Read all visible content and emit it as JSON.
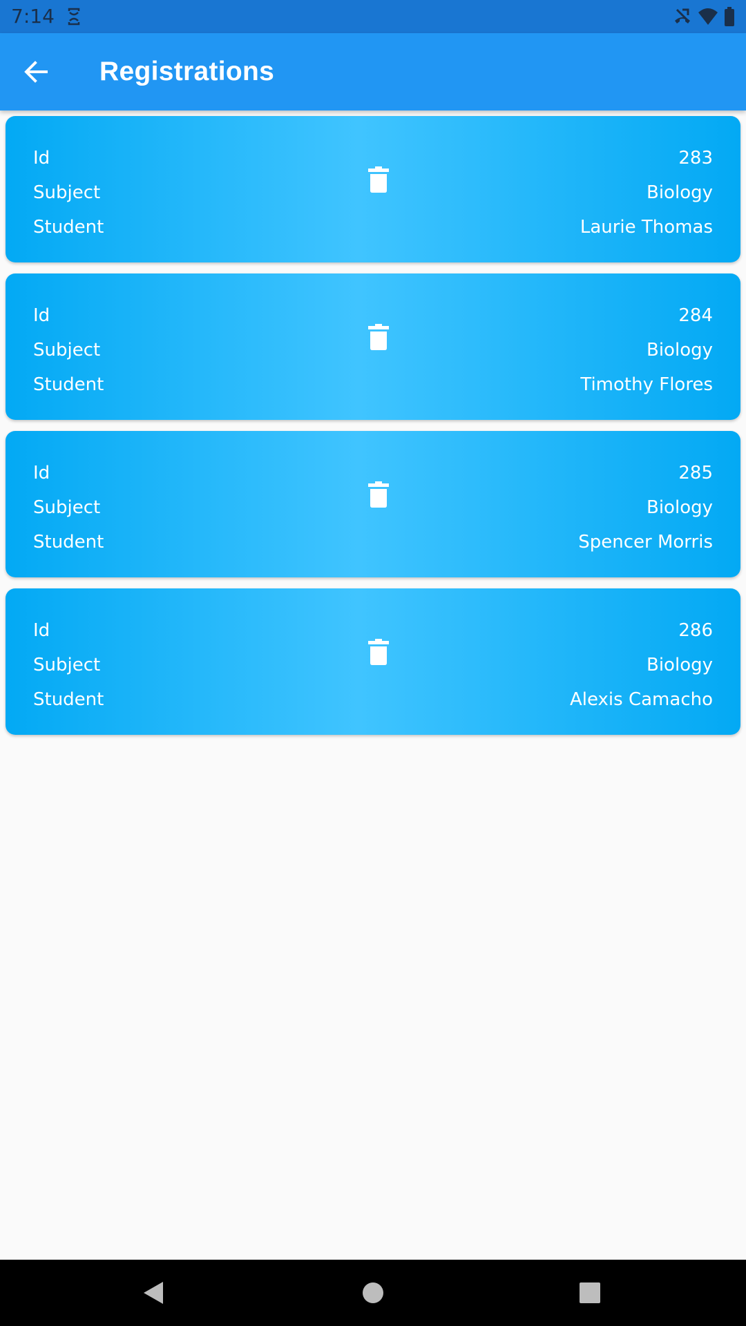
{
  "status_bar": {
    "time": "7:14",
    "icons": [
      "sync-icon",
      "no-calls-icon",
      "wifi-icon",
      "battery-icon"
    ]
  },
  "app_bar": {
    "title": "Registrations",
    "back_icon": "arrow-back-icon"
  },
  "colors": {
    "status_bar": "#1976d2",
    "app_bar": "#2196f3",
    "card_edge": "#03a9f4",
    "card_center": "#40c4ff",
    "background": "#fafafa"
  },
  "registrations": [
    {
      "id_label": "Id",
      "subject_label": "Subject",
      "student_label": "Student",
      "id": "283",
      "subject": "Biology",
      "student": "Laurie Thomas",
      "action_icon": "delete-icon"
    },
    {
      "id_label": "Id",
      "subject_label": "Subject",
      "student_label": "Student",
      "id": "284",
      "subject": "Biology",
      "student": "Timothy Flores",
      "action_icon": "delete-icon"
    },
    {
      "id_label": "Id",
      "subject_label": "Subject",
      "student_label": "Student",
      "id": "285",
      "subject": "Biology",
      "student": "Spencer Morris",
      "action_icon": "delete-icon"
    },
    {
      "id_label": "Id",
      "subject_label": "Subject",
      "student_label": "Student",
      "id": "286",
      "subject": "Biology",
      "student": "Alexis Camacho",
      "action_icon": "delete-icon"
    }
  ],
  "nav_bar": {
    "buttons": [
      "back-triangle-icon",
      "home-circle-icon",
      "recents-square-icon"
    ]
  }
}
